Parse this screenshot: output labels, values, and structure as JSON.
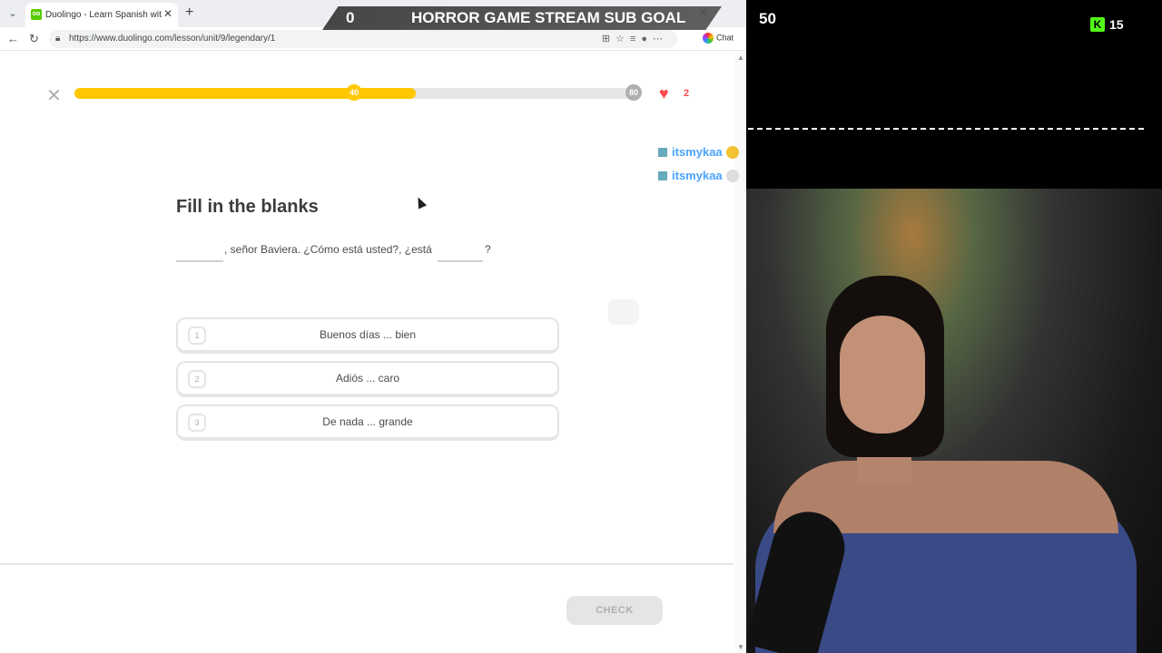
{
  "browser": {
    "tab_title": "Duolingo - Learn Spanish with less",
    "url": "https://www.duolingo.com/lesson/unit/9/legendary/1",
    "chat_label": "Chat"
  },
  "lesson": {
    "progress_fraction": 0.605,
    "milestone_mid": "40",
    "milestone_end": "80",
    "hearts": "2",
    "title": "Fill in the blanks",
    "sentence_middle": ", señor Baviera. ¿Cómo está usted?, ¿está",
    "sentence_end": "?",
    "choices": [
      {
        "num": "1",
        "label": "Buenos días ... bien"
      },
      {
        "num": "2",
        "label": "Adiós ... caro"
      },
      {
        "num": "3",
        "label": "De nada ... grande"
      }
    ],
    "check_label": "CHECK"
  },
  "overlay": {
    "sub_count": "0",
    "sub_goal_title": "HORROR GAME STREAM SUB GOAL",
    "sub_target": "50",
    "kick_badge": "K",
    "kick_count": "15",
    "chat": [
      {
        "user": "itsmykaa",
        "emote": "crown-emote"
      },
      {
        "user": "itsmykaa",
        "emote": "ghost-emote"
      }
    ]
  },
  "colors": {
    "duo_yellow": "#ffc800",
    "heart_red": "#ff4b4b",
    "kick_green": "#53fc18",
    "chat_blue": "#4aa3ff"
  }
}
